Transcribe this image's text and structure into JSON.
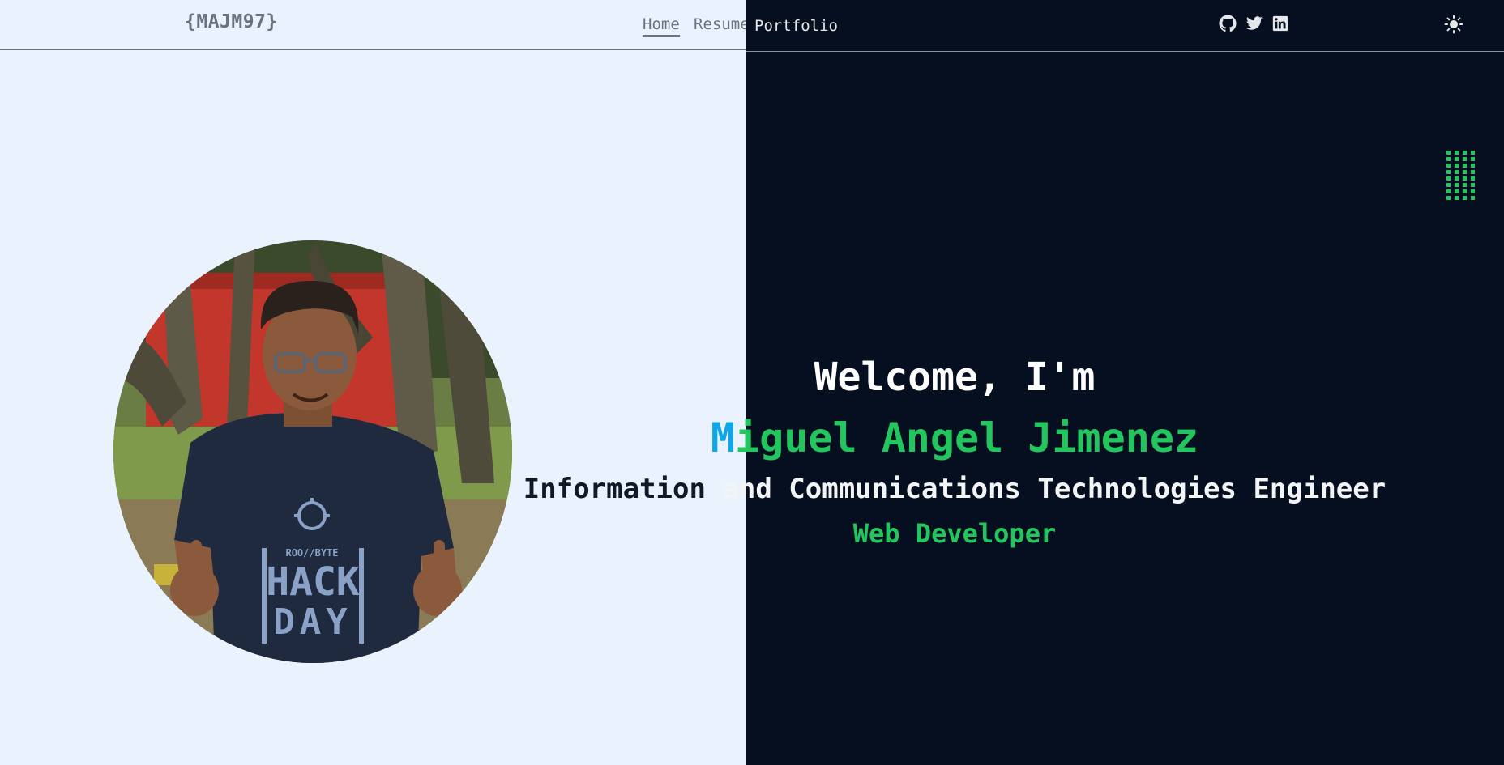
{
  "header": {
    "logo": "{MAJM97}",
    "nav": {
      "home": "Home",
      "resume": "Resume",
      "portfolio": "Portfolio"
    },
    "social_icons": [
      "github-icon",
      "twitter-icon",
      "linkedin-icon"
    ],
    "theme_toggle_icon": "sun-icon"
  },
  "hero": {
    "welcome": "Welcome, I'm",
    "name_first_char": "M",
    "name_rest": "iguel Angel Jimenez",
    "title_part1": "Information ",
    "title_part2": "and Communications Technologies Engineer",
    "role": "Web Developer",
    "photo_text_top": "ROO//BYTE",
    "photo_text_mid": "HACK",
    "photo_text_bottom": "DAY"
  },
  "colors": {
    "light_bg": "#eaf2fd",
    "dark_bg": "#050f1f",
    "accent_green": "#22c55e",
    "accent_blue": "#0ea5e9",
    "muted_text": "#6b7280"
  }
}
